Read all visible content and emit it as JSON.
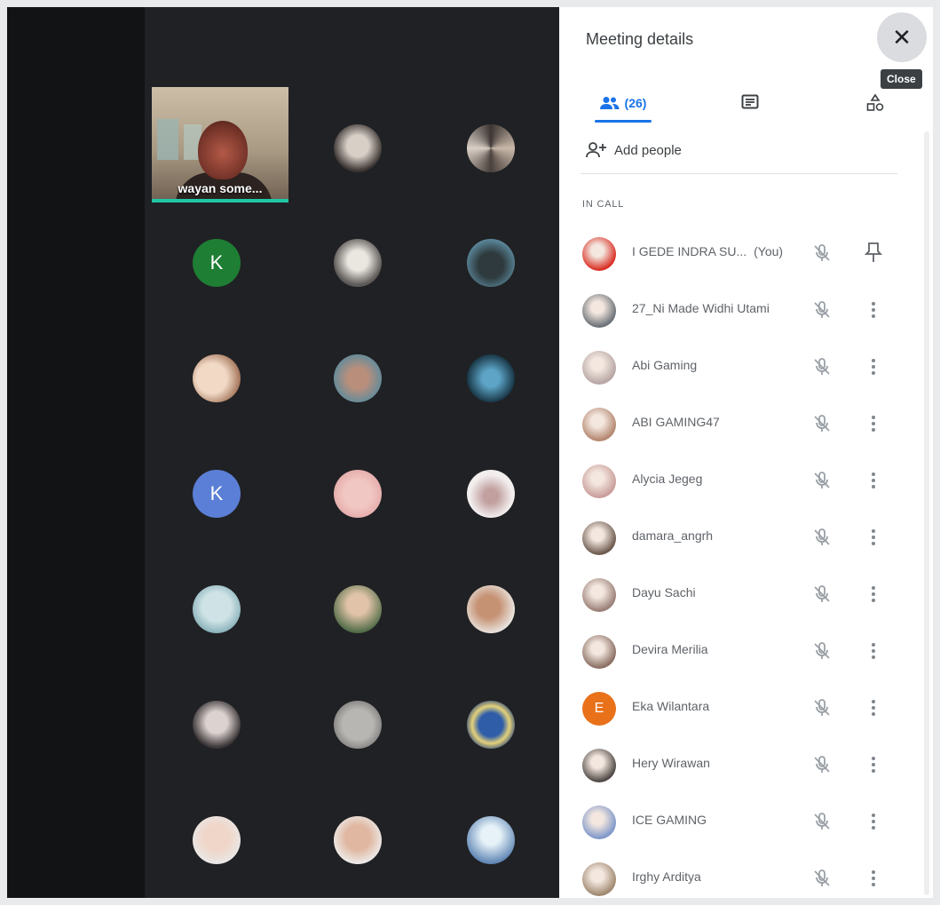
{
  "panel": {
    "title": "Meeting details",
    "close_tooltip": "Close",
    "tabs": {
      "people_count": "(26)"
    },
    "add_people_label": "Add people",
    "section_label": "IN CALL"
  },
  "video_tile": {
    "name": "wayan some..."
  },
  "grid_letters": {
    "k1": "K",
    "k2": "K"
  },
  "participants": [
    {
      "name": "I GEDE INDRA SU...",
      "you": "(You)",
      "color": "#d93025"
    },
    {
      "name": "27_Ni Made Widhi Utami",
      "color": "#6b7177"
    },
    {
      "name": "Abi Gaming",
      "color": "#b7a6a5"
    },
    {
      "name": "ABI GAMING47",
      "color": "#b48770"
    },
    {
      "name": "Alycia Jegeg",
      "color": "#c99d9a"
    },
    {
      "name": "damara_angrh",
      "color": "#6d5a4e"
    },
    {
      "name": "Dayu Sachi",
      "color": "#9a7f77"
    },
    {
      "name": "Devira Merilia",
      "color": "#8a6e62"
    },
    {
      "name": "Eka Wilantara",
      "initial": "E",
      "color": "#e8711a"
    },
    {
      "name": "Hery Wirawan",
      "color": "#4f4844"
    },
    {
      "name": "ICE GAMING",
      "color": "#7f97c9"
    },
    {
      "name": "Irghy Arditya",
      "color": "#a08970"
    }
  ]
}
